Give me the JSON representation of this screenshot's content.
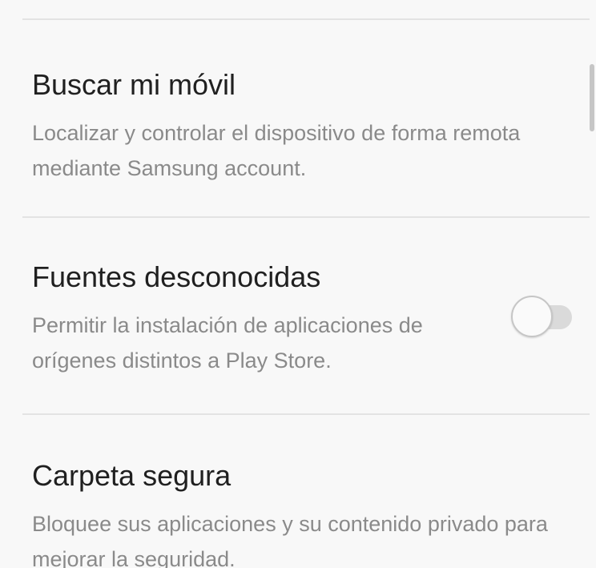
{
  "settings": {
    "items": [
      {
        "title": "Buscar mi móvil",
        "description_line1": "Localizar y controlar el dispositivo de forma remota",
        "description_line2": "mediante Samsung account."
      },
      {
        "title": "Fuentes desconocidas",
        "description_line1": "Permitir la instalación de aplicaciones de",
        "description_line2": "orígenes distintos a Play Store.",
        "toggle_state": "off"
      },
      {
        "title": "Carpeta segura",
        "description_line1": "Bloquee sus aplicaciones y su contenido privado para",
        "description_line2": "mejorar la seguridad."
      }
    ]
  },
  "colors": {
    "background": "#f8f8f8",
    "title_text": "#202020",
    "description_text": "#8a8a8a",
    "divider": "#e3e3e3",
    "toggle_track_off": "#dadada"
  }
}
